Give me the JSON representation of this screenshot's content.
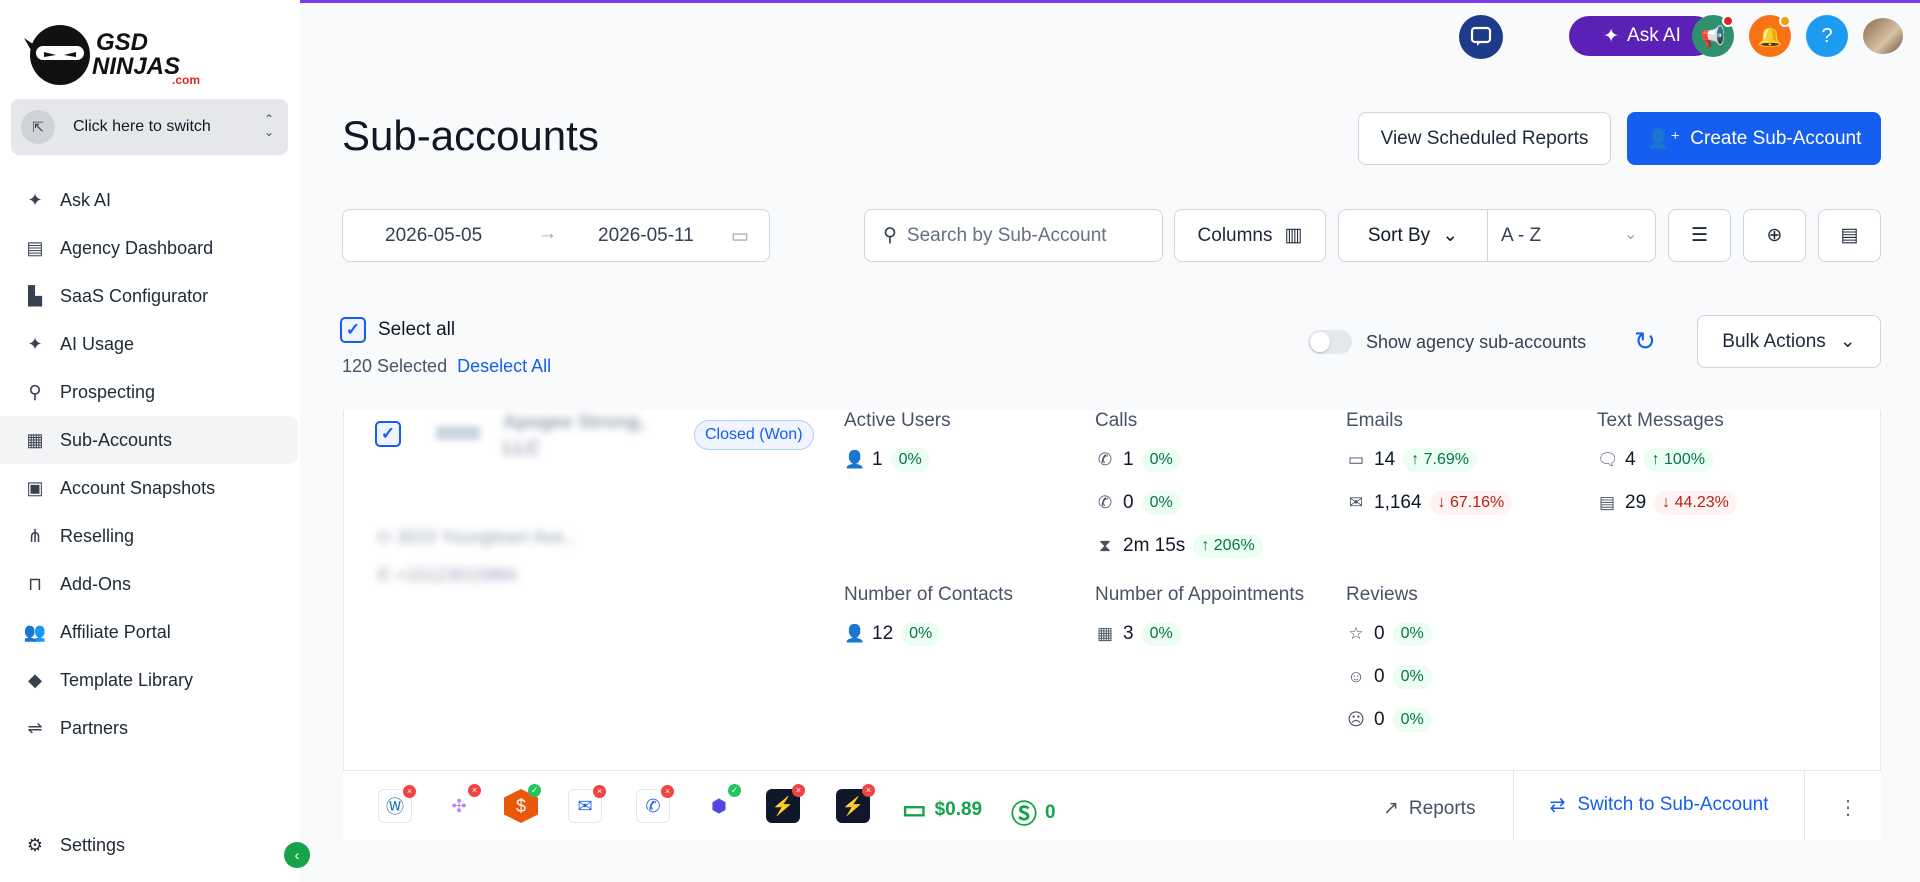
{
  "brand": {
    "name_line1": "GSD",
    "name_line2": "NINJAS",
    "domain": ".com"
  },
  "switcher": {
    "label": "Click here to switch"
  },
  "sidebar": {
    "items": [
      {
        "label": "Ask AI",
        "icon": "sparkle-icon"
      },
      {
        "label": "Agency Dashboard",
        "icon": "dashboard-icon"
      },
      {
        "label": "SaaS Configurator",
        "icon": "bar-chart-icon"
      },
      {
        "label": "AI Usage",
        "icon": "sparkle-icon"
      },
      {
        "label": "Prospecting",
        "icon": "user-search-icon"
      },
      {
        "label": "Sub-Accounts",
        "icon": "building-icon"
      },
      {
        "label": "Account Snapshots",
        "icon": "snapshot-icon"
      },
      {
        "label": "Reselling",
        "icon": "network-icon"
      },
      {
        "label": "Add-Ons",
        "icon": "bag-icon"
      },
      {
        "label": "Affiliate Portal",
        "icon": "users-icon"
      },
      {
        "label": "Template Library",
        "icon": "shapes-icon"
      },
      {
        "label": "Partners",
        "icon": "handshake-icon"
      }
    ],
    "settings_label": "Settings"
  },
  "header": {
    "ask_ai_label": "Ask AI",
    "help_label": "?"
  },
  "page": {
    "title": "Sub-accounts",
    "view_scheduled_label": "View Scheduled Reports",
    "create_label": "Create Sub-Account",
    "date_start": "2026-05-05",
    "date_end": "2026-05-11",
    "search_placeholder": "Search by Sub-Account",
    "columns_label": "Columns",
    "sort_by_label": "Sort By",
    "sort_value": "A - Z",
    "select_all_label": "Select all",
    "selected_count": "120 Selected",
    "deselect_label": "Deselect All",
    "show_agency_label": "Show agency sub-accounts",
    "bulk_actions_label": "Bulk Actions"
  },
  "card": {
    "name": "Apogee Strong, LLC",
    "address": "3033 Youngtown Ave.,",
    "phone": "+15123015884",
    "status_badge": "Closed (Won)",
    "active_users": {
      "title": "Active Users",
      "value": "1",
      "change": "0%"
    },
    "calls": {
      "title": "Calls",
      "inbound": "1",
      "inbound_change": "0%",
      "outbound": "0",
      "outbound_change": "0%",
      "duration": "2m 15s",
      "duration_change": "206%"
    },
    "emails": {
      "title": "Emails",
      "received": "14",
      "received_change": "7.69%",
      "sent": "1,164",
      "sent_change": "67.16%"
    },
    "texts": {
      "title": "Text Messages",
      "received": "4",
      "received_change": "100%",
      "sent": "29",
      "sent_change": "44.23%"
    },
    "contacts": {
      "title": "Number of Contacts",
      "value": "12",
      "change": "0%"
    },
    "appointments": {
      "title": "Number of Appointments",
      "value": "3",
      "change": "0%"
    },
    "reviews": {
      "title": "Reviews",
      "total": "0",
      "total_change": "0%",
      "positive": "0",
      "positive_change": "0%",
      "negative": "0",
      "negative_change": "0%"
    },
    "wallet": "$0.89",
    "credits": "0",
    "reports_label": "Reports",
    "switch_label": "Switch to Sub-Account"
  },
  "colors": {
    "primary": "#155eef",
    "ask_ai": "#5b21b6",
    "success": "#16a34a",
    "danger": "#b42318"
  }
}
